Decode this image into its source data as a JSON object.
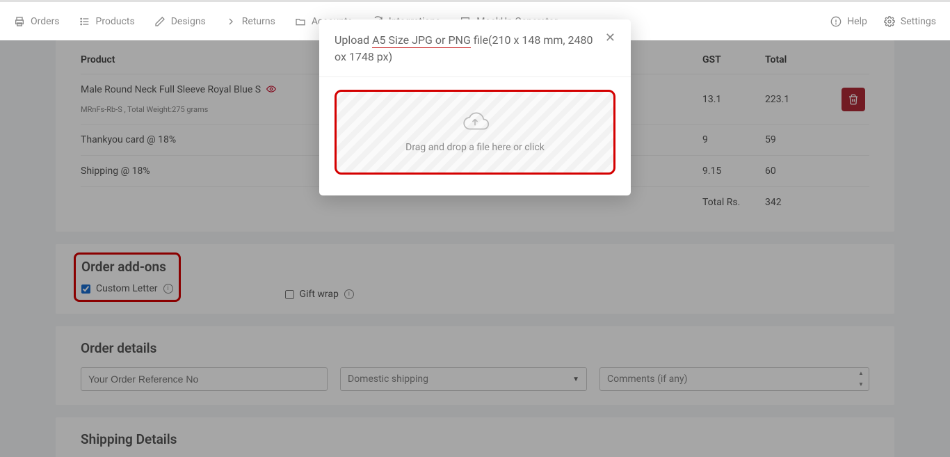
{
  "nav": {
    "orders": "Orders",
    "products": "Products",
    "designs": "Designs",
    "returns": "Returns",
    "accounts": "Accounts",
    "integrations": "Integrations",
    "mockup": "MockUp Generator",
    "help": "Help",
    "settings": "Settings"
  },
  "table": {
    "header_product": "Product",
    "header_gst": "GST",
    "header_total": "Total",
    "rows": [
      {
        "name": "Male Round Neck Full Sleeve Royal Blue S",
        "sub": "MRnFs-Rb-S , Total Weight:275 grams",
        "gst": "13.1",
        "total": "223.1",
        "has_eye": true,
        "has_trash": true
      },
      {
        "name": "Thankyou card @ 18%",
        "sub": "",
        "gst": "9",
        "total": "59"
      },
      {
        "name": "Shipping @ 18%",
        "sub": "",
        "gst": "9.15",
        "total": "60"
      }
    ],
    "footer_label": "Total Rs.",
    "footer_value": "342"
  },
  "addons": {
    "title": "Order add-ons",
    "custom_letter": "Custom Letter",
    "gift_wrap": "Gift wrap"
  },
  "order_details": {
    "title": "Order details",
    "ref_placeholder": "Your Order Reference No",
    "shipping_selected": "Domestic shipping",
    "comments_placeholder": "Comments (if any)"
  },
  "shipping": {
    "title": "Shipping Details"
  },
  "modal": {
    "title_prefix": "Upload ",
    "title_underlined": "A5 Size JPG or PNG",
    "title_suffix": " file(210 x 148 mm, 2480 ox 1748 px)",
    "dropzone_text": "Drag and drop a file here or click"
  }
}
